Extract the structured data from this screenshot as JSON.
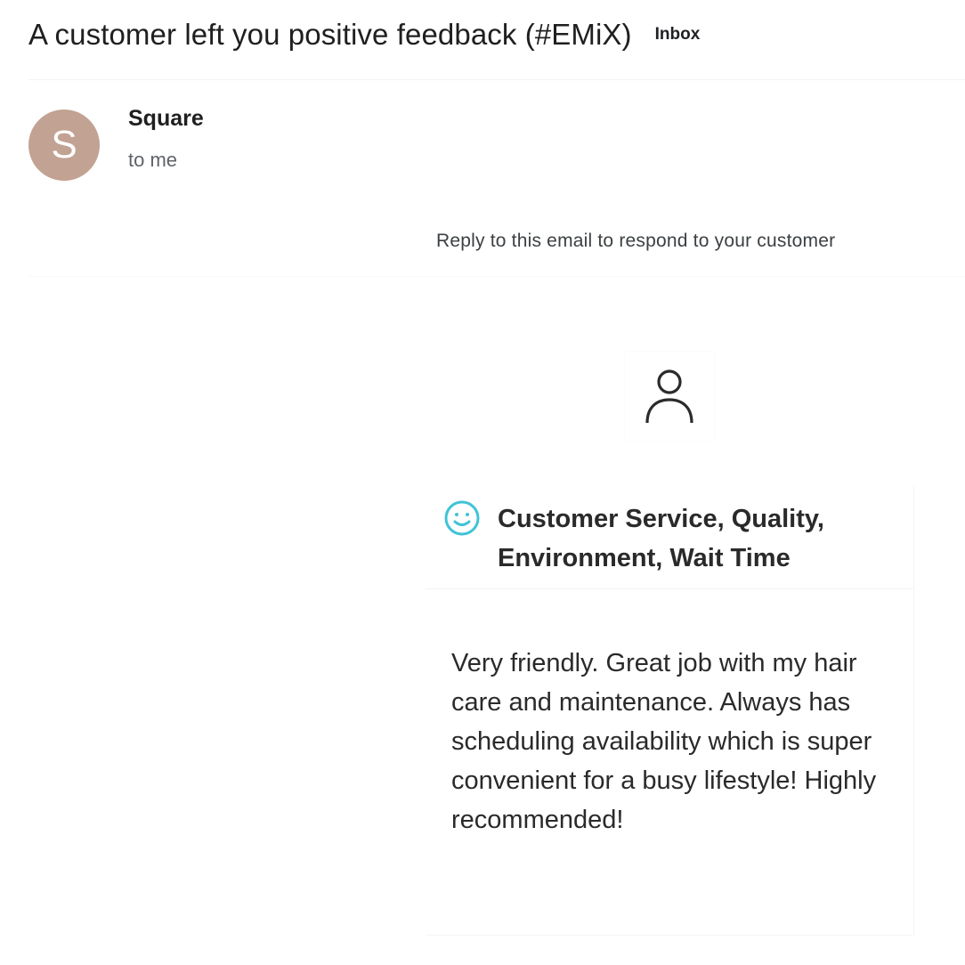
{
  "email": {
    "subject": "A customer left you positive feedback (#EMiX)",
    "label": "Inbox",
    "sender": {
      "initial": "S",
      "name": "Square",
      "recipient": "to me",
      "avatar_color": "#c2a293"
    },
    "body": {
      "reply_note": "Reply to this email to respond to your customer",
      "customer_icon": "person-icon",
      "sentiment_icon": "smiley-icon",
      "sentiment_color": "#3fc3d6",
      "categories": "Customer Service, Quality, Environment, Wait Time",
      "comment": "Very friendly. Great job with my hair care and maintenance. Always has scheduling availability which is super convenient for a busy lifestyle! Highly recommended!"
    }
  }
}
